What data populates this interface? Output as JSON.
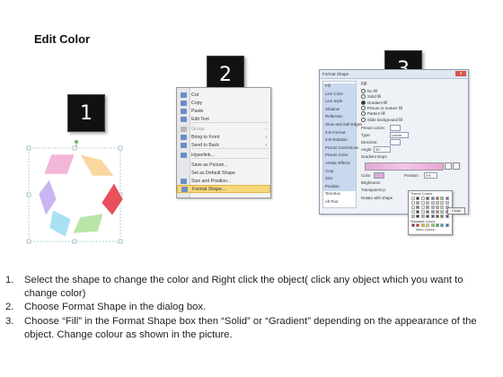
{
  "page": {
    "title": "Edit Color"
  },
  "badges": [
    "1",
    "2",
    "3"
  ],
  "colors": {
    "cycle": [
      "#f2b6d8",
      "#fbd7a0",
      "#e8505b",
      "#b9e5a8",
      "#a8e1f3",
      "#c7b6ef"
    ]
  },
  "context_menu": {
    "items": [
      {
        "label": "Cut",
        "icon": "scissors-icon",
        "disabled": false
      },
      {
        "label": "Copy",
        "icon": "copy-icon",
        "disabled": false
      },
      {
        "label": "Paste",
        "icon": "paste-icon",
        "disabled": false
      },
      {
        "label": "Edit Text",
        "icon": "edit-text-icon",
        "disabled": false
      },
      {
        "label": "Group",
        "icon": "group-icon",
        "disabled": true,
        "submenu": true
      },
      {
        "label": "Bring to Front",
        "icon": "bring-front-icon",
        "disabled": false,
        "submenu": true
      },
      {
        "label": "Send to Back",
        "icon": "send-back-icon",
        "disabled": false,
        "submenu": true
      },
      {
        "label": "Hyperlink...",
        "icon": "hyperlink-icon",
        "disabled": false
      },
      {
        "label": "Save as Picture...",
        "icon": "",
        "disabled": false
      },
      {
        "label": "Set as Default Shape",
        "icon": "",
        "disabled": false
      },
      {
        "label": "Size and Position...",
        "icon": "size-position-icon",
        "disabled": false
      },
      {
        "label": "Format Shape...",
        "icon": "format-shape-icon",
        "disabled": false,
        "highlighted": true
      }
    ],
    "submenu_glyph": "›"
  },
  "dialog": {
    "title": "Format Shape",
    "close": "x",
    "nav": [
      "Fill",
      "Line Color",
      "Line Style",
      "Shadow",
      "Reflection",
      "Glow and Soft Edges",
      "3-D Format",
      "3-D Rotation",
      "Picture Corrections",
      "Picture Color",
      "Artistic Effects",
      "Crop",
      "Size",
      "Position",
      "Text Box",
      "Alt Text"
    ],
    "section": "Fill",
    "options": [
      "No fill",
      "Solid fill",
      "Gradient fill",
      "Picture or texture fill",
      "Pattern fill",
      "Slide background fill"
    ],
    "selected_option": "Gradient fill",
    "labels": {
      "preset": "Preset colors:",
      "type": "Type:",
      "type_value": "Linear",
      "direction": "Direction:",
      "angle": "Angle:",
      "angle_value": "45°",
      "stops": "Gradient stops",
      "color": "Color",
      "position": "Position:",
      "position_value": "0%",
      "brightness": "Brightness:",
      "transparency": "Transparency:",
      "rotate": "Rotate with shape",
      "close_button": "Close"
    },
    "palette": {
      "theme_label": "Theme Colors",
      "standard_label": "Standard Colors",
      "more_label": "More Colors...",
      "theme_row": [
        "#ffffff",
        "#000000",
        "#eeece1",
        "#1f497d",
        "#4f81bd",
        "#c0504d",
        "#9bbb59",
        "#8064a2"
      ],
      "standard_row": [
        "#c00000",
        "#ff0000",
        "#ffc000",
        "#ffff00",
        "#92d050",
        "#00b050",
        "#00b0f0",
        "#0070c0"
      ]
    }
  },
  "steps": [
    {
      "num": "1.",
      "text": "Select the shape to change the color and Right click the object( click any object which you want to change color)"
    },
    {
      "num": "2.",
      "text": "Choose Format Shape in the dialog box."
    },
    {
      "num": "3.",
      "text": "Choose “Fill” in the Format Shape box then “Solid” or “Gradient” depending on the appearance of the object. Change colour as shown in the picture."
    }
  ]
}
